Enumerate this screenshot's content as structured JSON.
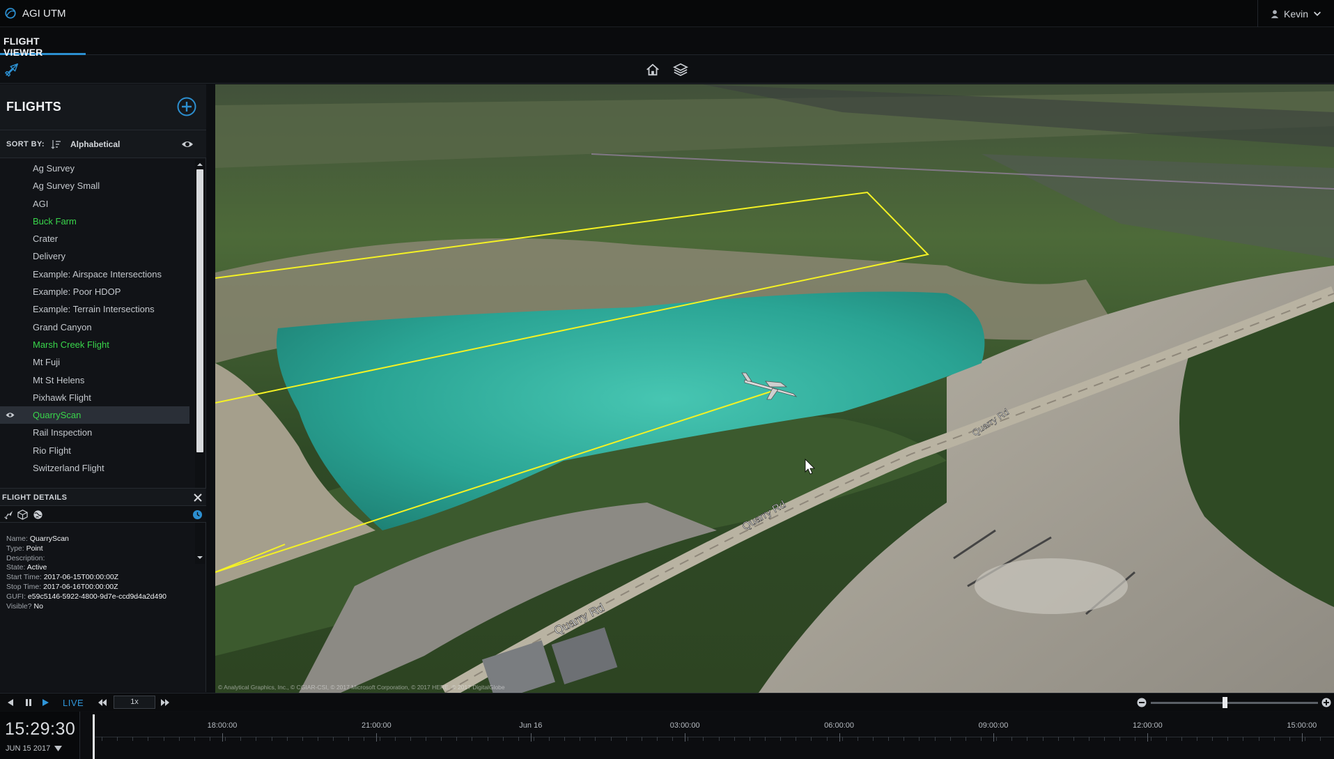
{
  "app": {
    "title": "AGI UTM",
    "user": "Kevin"
  },
  "tabs": [
    {
      "label": "FLIGHT VIEWER",
      "active": true
    }
  ],
  "flights_panel": {
    "title": "FLIGHTS",
    "sort_label": "SORT BY:",
    "sort_value": "Alphabetical",
    "items": [
      {
        "label": "Ag Survey",
        "status": "normal"
      },
      {
        "label": "Ag Survey Small",
        "status": "normal"
      },
      {
        "label": "AGI",
        "status": "normal"
      },
      {
        "label": "Buck Farm",
        "status": "active"
      },
      {
        "label": "Crater",
        "status": "normal"
      },
      {
        "label": "Delivery",
        "status": "normal"
      },
      {
        "label": "Example: Airspace Intersections",
        "status": "normal"
      },
      {
        "label": "Example: Poor HDOP",
        "status": "normal"
      },
      {
        "label": "Example: Terrain Intersections",
        "status": "normal"
      },
      {
        "label": "Grand Canyon",
        "status": "normal"
      },
      {
        "label": "Marsh Creek Flight",
        "status": "active"
      },
      {
        "label": "Mt Fuji",
        "status": "normal"
      },
      {
        "label": "Mt St Helens",
        "status": "normal"
      },
      {
        "label": "Pixhawk Flight",
        "status": "normal"
      },
      {
        "label": "QuarryScan",
        "status": "active",
        "selected": true,
        "visible": true
      },
      {
        "label": "Rail Inspection",
        "status": "normal"
      },
      {
        "label": "Rio Flight",
        "status": "normal"
      },
      {
        "label": "Switzerland Flight",
        "status": "normal"
      }
    ]
  },
  "flight_details": {
    "title": "FLIGHT DETAILS",
    "fields": [
      {
        "key": "Name:",
        "value": "QuarryScan"
      },
      {
        "key": "Type:",
        "value": "Point"
      },
      {
        "key": "Description:",
        "value": ""
      },
      {
        "key": "State:",
        "value": "Active"
      },
      {
        "key": "Start Time:",
        "value": "2017-06-15T00:00:00Z"
      },
      {
        "key": "Stop Time:",
        "value": "2017-06-16T00:00:00Z"
      },
      {
        "key": "GUFI:",
        "value": "e59c5146-5922-4800-9d7e-ccd9d4a2d490"
      },
      {
        "key": "Visible?",
        "value": "No"
      }
    ]
  },
  "map": {
    "road_labels": [
      "Quarry Rd",
      "Quarry Rd",
      "Quarry Rd"
    ],
    "credits": "© Analytical Graphics, Inc., © CGIAR-CSI, © 2017 Microsoft Corporation, © 2017 HERE, © 2017 DigitalGlobe"
  },
  "playback": {
    "live_label": "LIVE",
    "speed": "1x",
    "zoom_level": 0.44
  },
  "timeline": {
    "clock_time": "15:29:30",
    "clock_date": "JUN 15 2017",
    "ticks": [
      "18:00:00",
      "21:00:00",
      "Jun 16",
      "03:00:00",
      "06:00:00",
      "09:00:00",
      "12:00:00",
      "15:00:00"
    ]
  },
  "colors": {
    "accent": "#2c8fd0",
    "active_flight": "#39d64b",
    "flight_path": "#f5f224",
    "water": "#2fb5a2"
  },
  "icons": {
    "brand": "globe-icon",
    "user": "user-icon",
    "tool": "airplane-icon",
    "home": "home-icon",
    "layers": "layers-icon",
    "add": "plus-circle-icon",
    "sort": "sort-list-icon",
    "eye": "eye-icon",
    "close": "close-icon",
    "clock": "clock-icon"
  }
}
